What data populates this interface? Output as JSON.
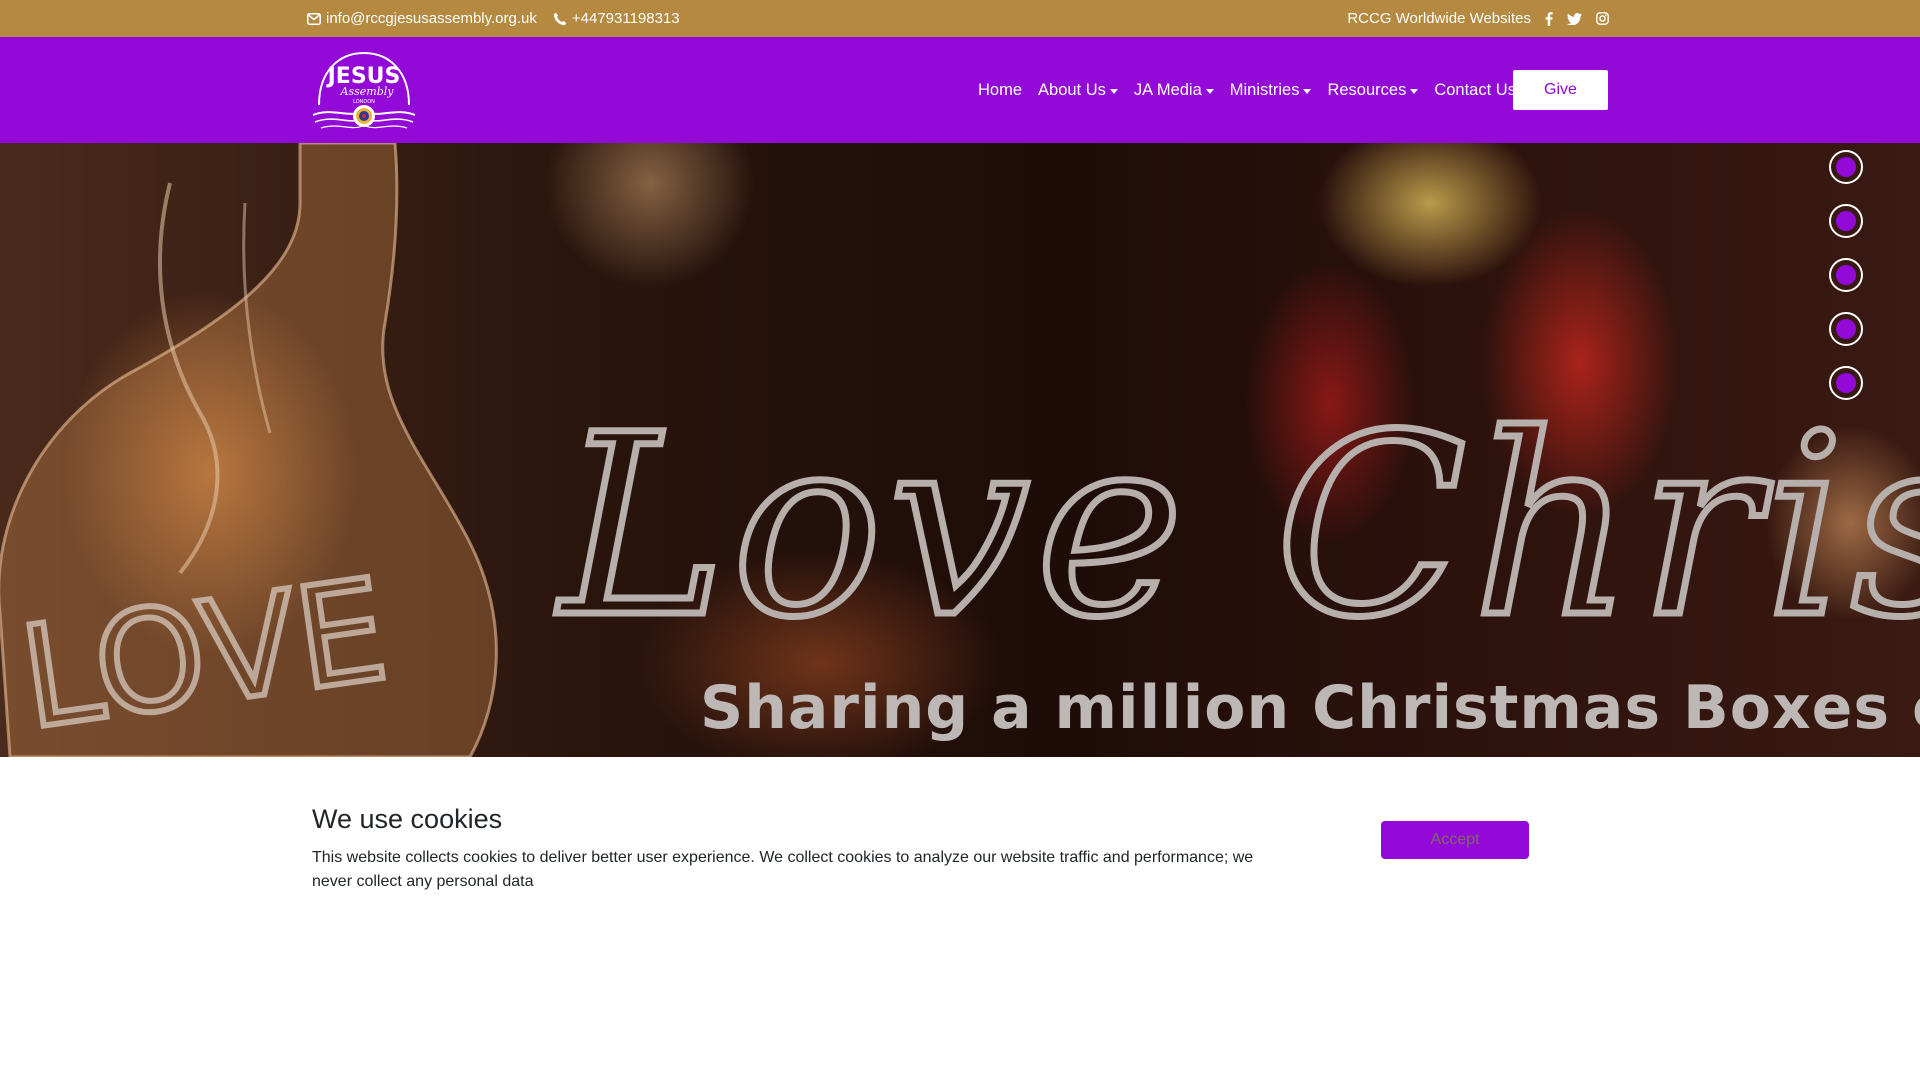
{
  "topbar": {
    "email": "info@rccgjesusassembly.org.uk",
    "phone": "+447931198313",
    "worldwide_link": "RCCG Worldwide Websites",
    "social_icons": [
      "facebook-icon",
      "twitter-icon",
      "instagram-icon"
    ]
  },
  "navbar": {
    "logo": {
      "line1": "JESUS",
      "line2": "Assembly",
      "line3": "LONDON"
    },
    "items": [
      {
        "label": "Home",
        "dropdown": false
      },
      {
        "label": "About Us",
        "dropdown": true
      },
      {
        "label": "JA Media",
        "dropdown": true
      },
      {
        "label": "Ministries",
        "dropdown": true
      },
      {
        "label": "Resources",
        "dropdown": true
      },
      {
        "label": "Contact Us",
        "dropdown": false
      }
    ],
    "give_label": "Give"
  },
  "hero": {
    "script_text": "Love Christmas",
    "subtitle": "Sharing a million Christmas Boxes of",
    "bulb_text": "LOVE",
    "slide_count": 5
  },
  "cookie": {
    "title": "We use cookies",
    "message": "This website collects cookies to deliver better user experience. We collect cookies to analyze our website traffic and performance; we never collect any personal data",
    "accept_label": "Accept"
  },
  "colors": {
    "topbar": "#b5893f",
    "brand_purple": "#9309d8",
    "white": "#ffffff"
  }
}
